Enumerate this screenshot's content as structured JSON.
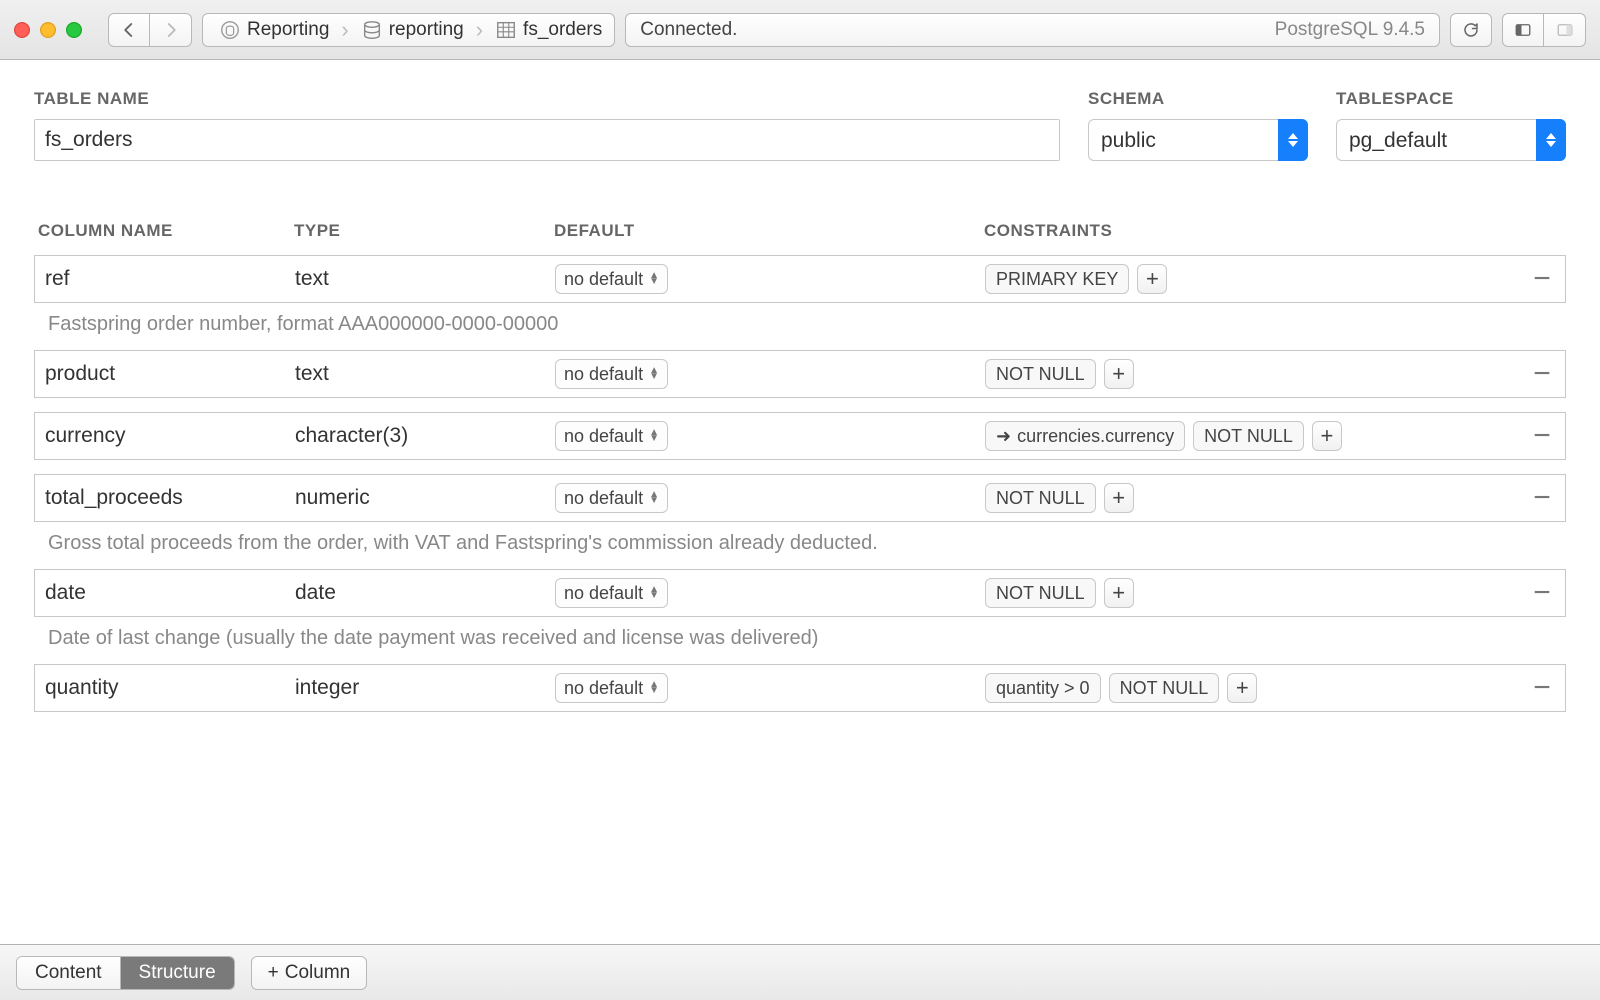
{
  "toolbar": {
    "breadcrumb": {
      "db": "Reporting",
      "schema": "reporting",
      "table": "fs_orders"
    },
    "status_left": "Connected.",
    "status_right": "PostgreSQL 9.4.5"
  },
  "labels": {
    "table_name": "TABLE NAME",
    "schema": "SCHEMA",
    "tablespace": "TABLESPACE",
    "column_name": "COLUMN NAME",
    "type": "TYPE",
    "default": "DEFAULT",
    "constraints": "CONSTRAINTS"
  },
  "form": {
    "table_name": "fs_orders",
    "schema": "public",
    "tablespace": "pg_default"
  },
  "default_label": "no default",
  "plus_label": "+",
  "minus_label": "−",
  "fk_arrow": "➜",
  "columns": [
    {
      "name": "ref",
      "type": "text",
      "constraints": [
        {
          "kind": "pk",
          "label": "PRIMARY KEY"
        }
      ],
      "comment": "Fastspring order number, format AAA000000-0000-00000"
    },
    {
      "name": "product",
      "type": "text",
      "constraints": [
        {
          "kind": "nn",
          "label": "NOT NULL"
        }
      ],
      "comment": ""
    },
    {
      "name": "currency",
      "type": "character(3)",
      "constraints": [
        {
          "kind": "fk",
          "label": "currencies.currency"
        },
        {
          "kind": "nn",
          "label": "NOT NULL"
        }
      ],
      "comment": ""
    },
    {
      "name": "total_proceeds",
      "type": "numeric",
      "constraints": [
        {
          "kind": "nn",
          "label": "NOT NULL"
        }
      ],
      "comment": "Gross total proceeds from the order, with VAT and Fastspring's commission already deducted."
    },
    {
      "name": "date",
      "type": "date",
      "constraints": [
        {
          "kind": "nn",
          "label": "NOT NULL"
        }
      ],
      "comment": "Date of last change (usually the date payment was received and license was delivered)"
    },
    {
      "name": "quantity",
      "type": "integer",
      "constraints": [
        {
          "kind": "check",
          "label": "quantity > 0"
        },
        {
          "kind": "nn",
          "label": "NOT NULL"
        }
      ],
      "comment": ""
    }
  ],
  "footer": {
    "tabs": {
      "content": "Content",
      "structure": "Structure"
    },
    "add_column": "Column"
  }
}
